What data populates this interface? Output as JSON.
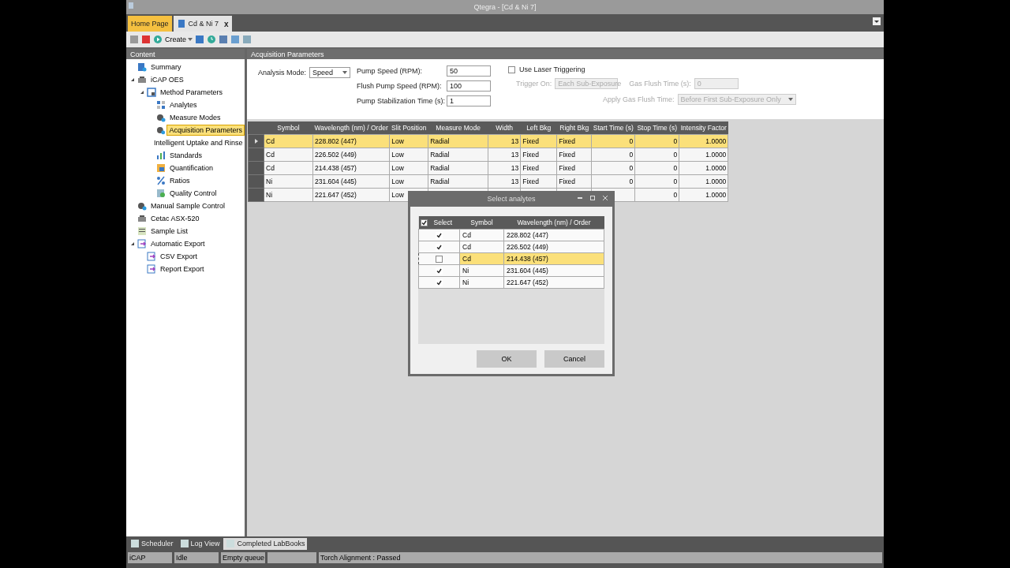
{
  "window": {
    "title": "Qtegra - [Cd & Ni 7]"
  },
  "tabs": [
    {
      "label": "Home Page",
      "selected": true
    },
    {
      "label": "Cd & Ni 7",
      "selected": false,
      "close": "x"
    }
  ],
  "toolbar": {
    "create": "Create"
  },
  "sidebar": {
    "title": "Content",
    "items": [
      {
        "label": "Summary",
        "kind": "info",
        "selected": false
      },
      {
        "label": "iCAP OES",
        "kind": "device",
        "selected": false,
        "expanded": true,
        "children": [
          {
            "label": "Method Parameters",
            "kind": "method",
            "selected": false,
            "expanded": true,
            "children": [
              {
                "label": "Analytes",
                "kind": "grid",
                "selected": false
              },
              {
                "label": "Measure Modes",
                "kind": "gear",
                "selected": false
              },
              {
                "label": "Acquisition Parameters",
                "kind": "gear",
                "selected": true
              },
              {
                "label": "Intelligent Uptake and Rinse",
                "kind": "uptake",
                "selected": false
              },
              {
                "label": "Standards",
                "kind": "bars",
                "selected": false
              },
              {
                "label": "Quantification",
                "kind": "quant",
                "selected": false
              },
              {
                "label": "Ratios",
                "kind": "percent",
                "selected": false
              },
              {
                "label": "Quality Control",
                "kind": "qc",
                "selected": false
              }
            ]
          }
        ]
      },
      {
        "label": "Manual Sample Control",
        "kind": "gear",
        "selected": false
      },
      {
        "label": "Cetac ASX-520",
        "kind": "device",
        "selected": false
      },
      {
        "label": "Sample List",
        "kind": "list",
        "selected": false
      },
      {
        "label": "Automatic Export",
        "kind": "export",
        "selected": false,
        "expanded": true,
        "children": [
          {
            "label": "CSV Export",
            "kind": "export",
            "selected": false
          },
          {
            "label": "Report Export",
            "kind": "export",
            "selected": false
          }
        ]
      }
    ]
  },
  "panel": {
    "title": "Acquisition Parameters",
    "analysis_mode": {
      "label": "Analysis Mode:",
      "value": "Speed"
    },
    "pump_fields": [
      {
        "label": "Pump Speed (RPM):",
        "value": "50"
      },
      {
        "label": "Flush Pump Speed (RPM):",
        "value": "100"
      },
      {
        "label": "Pump Stabilization Time (s):",
        "value": "1"
      }
    ],
    "laser": {
      "label": "Use Laser Triggering",
      "checked": false
    },
    "trigger_on": {
      "label": "Trigger On:",
      "value": "Each Sub-Exposure",
      "disabled": true
    },
    "gas_flush_time": {
      "label": "Gas Flush Time (s):",
      "value": "0",
      "disabled": true
    },
    "apply_gas_flush": {
      "label": "Apply Gas Flush Time:",
      "value": "Before First Sub-Exposure Only",
      "disabled": true
    }
  },
  "grid": {
    "columns": [
      "Symbol",
      "Wavelength (nm) / Order",
      "Slit Position",
      "Measure Mode",
      "Width",
      "Left Bkg",
      "Right Bkg",
      "Start Time (s)",
      "Stop Time (s)",
      "Intensity Factor"
    ],
    "rows": [
      {
        "selected": true,
        "cells": [
          "Cd",
          "228.802 (447)",
          "Low",
          "Radial",
          "13",
          "Fixed",
          "Fixed",
          "0",
          "0",
          "1.0000"
        ]
      },
      {
        "selected": false,
        "cells": [
          "Cd",
          "226.502 (449)",
          "Low",
          "Radial",
          "13",
          "Fixed",
          "Fixed",
          "0",
          "0",
          "1.0000"
        ]
      },
      {
        "selected": false,
        "cells": [
          "Cd",
          "214.438 (457)",
          "Low",
          "Radial",
          "13",
          "Fixed",
          "Fixed",
          "0",
          "0",
          "1.0000"
        ]
      },
      {
        "selected": false,
        "cells": [
          "Ni",
          "231.604 (445)",
          "Low",
          "Radial",
          "13",
          "Fixed",
          "Fixed",
          "0",
          "0",
          "1.0000"
        ]
      },
      {
        "selected": false,
        "cells": [
          "Ni",
          "221.647 (452)",
          "Low",
          null,
          null,
          null,
          null,
          null,
          "0",
          "1.0000"
        ]
      }
    ]
  },
  "dialog": {
    "title": "Select analytes",
    "header_checked": true,
    "columns": [
      "Select",
      "Symbol",
      "Wavelength (nm) / Order"
    ],
    "rows": [
      {
        "checked": true,
        "selected": false,
        "symbol": "Cd",
        "wavelength": "228.802 (447)"
      },
      {
        "checked": true,
        "selected": false,
        "symbol": "Cd",
        "wavelength": "226.502 (449)"
      },
      {
        "checked": false,
        "selected": true,
        "symbol": "Cd",
        "wavelength": "214.438 (457)"
      },
      {
        "checked": true,
        "selected": false,
        "symbol": "Ni",
        "wavelength": "231.604 (445)"
      },
      {
        "checked": true,
        "selected": false,
        "symbol": "Ni",
        "wavelength": "221.647 (452)"
      }
    ],
    "buttons": [
      "OK",
      "Cancel"
    ]
  },
  "bottom_tabs": [
    {
      "label": "Scheduler",
      "selected": false
    },
    {
      "label": "Log View",
      "selected": false
    },
    {
      "label": "Completed LabBooks",
      "selected": true
    }
  ],
  "status_bar": [
    {
      "kind": "text",
      "text": "iCAP"
    },
    {
      "kind": "text",
      "text": "Idle"
    },
    {
      "kind": "text",
      "text": "Empty queue"
    },
    {
      "kind": "blank"
    },
    {
      "kind": "text",
      "text": "Torch Alignment : Passed"
    }
  ]
}
